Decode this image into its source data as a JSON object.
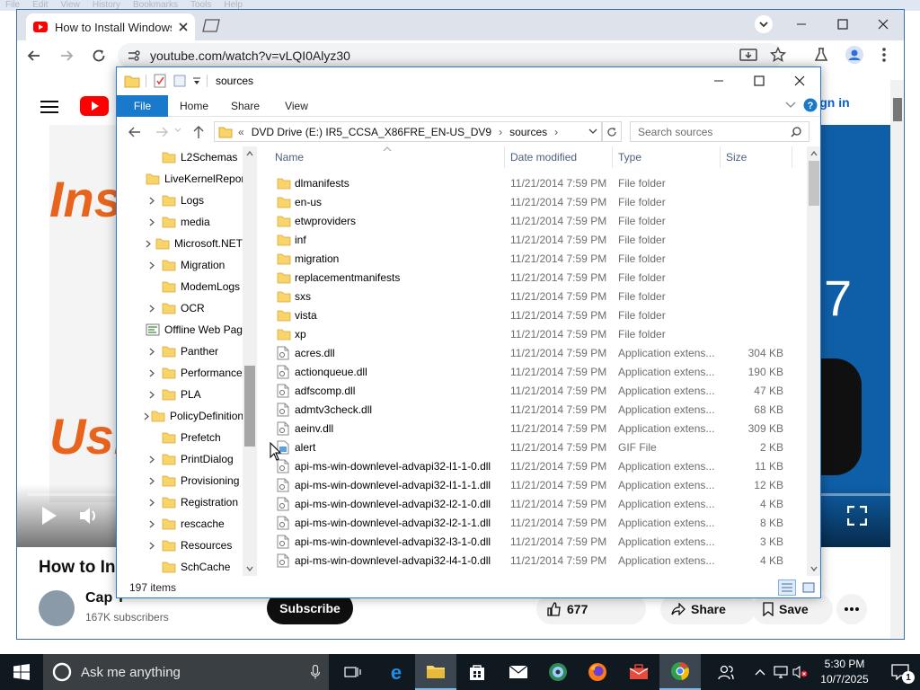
{
  "background_menu": [
    "File",
    "Edit",
    "View",
    "History",
    "Bookmarks",
    "Tools",
    "Help"
  ],
  "browser": {
    "tab_title": "How to Install Windows",
    "url": "youtube.com/watch?v=vLQI0Alyz30"
  },
  "youtube": {
    "signin_label": "Sign in",
    "video_overlay_line1": "Ins",
    "video_overlay_line2": "Usi",
    "video_overlay_right": "7",
    "video_title": "How to Ins",
    "channel_name": "Cap T",
    "subscribers": "167K subscribers",
    "subscribe_label": "Subscribe",
    "like_count": "677",
    "share_label": "Share",
    "save_label": "Save"
  },
  "explorer": {
    "title": "sources",
    "ribbon_tabs": [
      "File",
      "Home",
      "Share",
      "View"
    ],
    "address": {
      "prefix": "«",
      "segments": [
        "DVD Drive (E:) IR5_CCSA_X86FRE_EN-US_DV9",
        "sources"
      ]
    },
    "search_placeholder": "Search sources",
    "columns": [
      "Name",
      "Date modified",
      "Type",
      "Size"
    ],
    "nav_items": [
      {
        "label": "L2Schemas",
        "expandable": false,
        "icon": "folder-icon"
      },
      {
        "label": "LiveKernelReports",
        "expandable": false,
        "icon": "folder-icon"
      },
      {
        "label": "Logs",
        "expandable": true,
        "icon": "folder-icon"
      },
      {
        "label": "media",
        "expandable": true,
        "icon": "folder-icon"
      },
      {
        "label": "Microsoft.NET",
        "expandable": true,
        "icon": "folder-icon"
      },
      {
        "label": "Migration",
        "expandable": true,
        "icon": "folder-icon"
      },
      {
        "label": "ModemLogs",
        "expandable": false,
        "icon": "folder-icon"
      },
      {
        "label": "OCR",
        "expandable": true,
        "icon": "folder-icon"
      },
      {
        "label": "Offline Web Pages",
        "expandable": false,
        "icon": "offline-web-pages-icon"
      },
      {
        "label": "Panther",
        "expandable": true,
        "icon": "folder-icon"
      },
      {
        "label": "Performance",
        "expandable": true,
        "icon": "folder-icon"
      },
      {
        "label": "PLA",
        "expandable": true,
        "icon": "folder-icon"
      },
      {
        "label": "PolicyDefinitions",
        "expandable": true,
        "icon": "folder-icon"
      },
      {
        "label": "Prefetch",
        "expandable": false,
        "icon": "folder-icon"
      },
      {
        "label": "PrintDialog",
        "expandable": true,
        "icon": "folder-icon"
      },
      {
        "label": "Provisioning",
        "expandable": true,
        "icon": "folder-icon"
      },
      {
        "label": "Registration",
        "expandable": true,
        "icon": "folder-icon"
      },
      {
        "label": "rescache",
        "expandable": true,
        "icon": "folder-icon"
      },
      {
        "label": "Resources",
        "expandable": true,
        "icon": "folder-icon"
      },
      {
        "label": "SchCache",
        "expandable": false,
        "icon": "folder-icon"
      }
    ],
    "files": [
      {
        "name": "dlmanifests",
        "date": "11/21/2014 7:59 PM",
        "type": "File folder",
        "size": "",
        "icon": "folder-icon"
      },
      {
        "name": "en-us",
        "date": "11/21/2014 7:59 PM",
        "type": "File folder",
        "size": "",
        "icon": "folder-icon"
      },
      {
        "name": "etwproviders",
        "date": "11/21/2014 7:59 PM",
        "type": "File folder",
        "size": "",
        "icon": "folder-icon"
      },
      {
        "name": "inf",
        "date": "11/21/2014 7:59 PM",
        "type": "File folder",
        "size": "",
        "icon": "folder-icon"
      },
      {
        "name": "migration",
        "date": "11/21/2014 7:59 PM",
        "type": "File folder",
        "size": "",
        "icon": "folder-icon"
      },
      {
        "name": "replacementmanifests",
        "date": "11/21/2014 7:59 PM",
        "type": "File folder",
        "size": "",
        "icon": "folder-icon"
      },
      {
        "name": "sxs",
        "date": "11/21/2014 7:59 PM",
        "type": "File folder",
        "size": "",
        "icon": "folder-icon"
      },
      {
        "name": "vista",
        "date": "11/21/2014 7:59 PM",
        "type": "File folder",
        "size": "",
        "icon": "folder-icon"
      },
      {
        "name": "xp",
        "date": "11/21/2014 7:59 PM",
        "type": "File folder",
        "size": "",
        "icon": "folder-icon"
      },
      {
        "name": "acres.dll",
        "date": "11/21/2014 7:59 PM",
        "type": "Application extens...",
        "size": "304 KB",
        "icon": "dll-file-icon"
      },
      {
        "name": "actionqueue.dll",
        "date": "11/21/2014 7:59 PM",
        "type": "Application extens...",
        "size": "190 KB",
        "icon": "dll-file-icon"
      },
      {
        "name": "adfscomp.dll",
        "date": "11/21/2014 7:59 PM",
        "type": "Application extens...",
        "size": "47 KB",
        "icon": "dll-file-icon"
      },
      {
        "name": "admtv3check.dll",
        "date": "11/21/2014 7:59 PM",
        "type": "Application extens...",
        "size": "68 KB",
        "icon": "dll-file-icon"
      },
      {
        "name": "aeinv.dll",
        "date": "11/21/2014 7:59 PM",
        "type": "Application extens...",
        "size": "309 KB",
        "icon": "dll-file-icon"
      },
      {
        "name": "alert",
        "date": "11/21/2014 7:59 PM",
        "type": "GIF File",
        "size": "2 KB",
        "icon": "gif-file-icon"
      },
      {
        "name": "api-ms-win-downlevel-advapi32-l1-1-0.dll",
        "date": "11/21/2014 7:59 PM",
        "type": "Application extens...",
        "size": "11 KB",
        "icon": "dll-file-icon"
      },
      {
        "name": "api-ms-win-downlevel-advapi32-l1-1-1.dll",
        "date": "11/21/2014 7:59 PM",
        "type": "Application extens...",
        "size": "12 KB",
        "icon": "dll-file-icon"
      },
      {
        "name": "api-ms-win-downlevel-advapi32-l2-1-0.dll",
        "date": "11/21/2014 7:59 PM",
        "type": "Application extens...",
        "size": "4 KB",
        "icon": "dll-file-icon"
      },
      {
        "name": "api-ms-win-downlevel-advapi32-l2-1-1.dll",
        "date": "11/21/2014 7:59 PM",
        "type": "Application extens...",
        "size": "8 KB",
        "icon": "dll-file-icon"
      },
      {
        "name": "api-ms-win-downlevel-advapi32-l3-1-0.dll",
        "date": "11/21/2014 7:59 PM",
        "type": "Application extens...",
        "size": "3 KB",
        "icon": "dll-file-icon"
      },
      {
        "name": "api-ms-win-downlevel-advapi32-l4-1-0.dll",
        "date": "11/21/2014 7:59 PM",
        "type": "Application extens...",
        "size": "4 KB",
        "icon": "dll-file-icon"
      }
    ],
    "item_count": "197 items"
  },
  "taskbar": {
    "search_placeholder": "Ask me anything",
    "time": "5:30 PM",
    "date": "10/7/2025",
    "notification_count": "1"
  },
  "colors": {
    "explorer_accent": "#1979ca",
    "folder_yellow": "#f8d46a",
    "youtube_red": "#ff0000",
    "taskbar_bg": "#101820"
  }
}
